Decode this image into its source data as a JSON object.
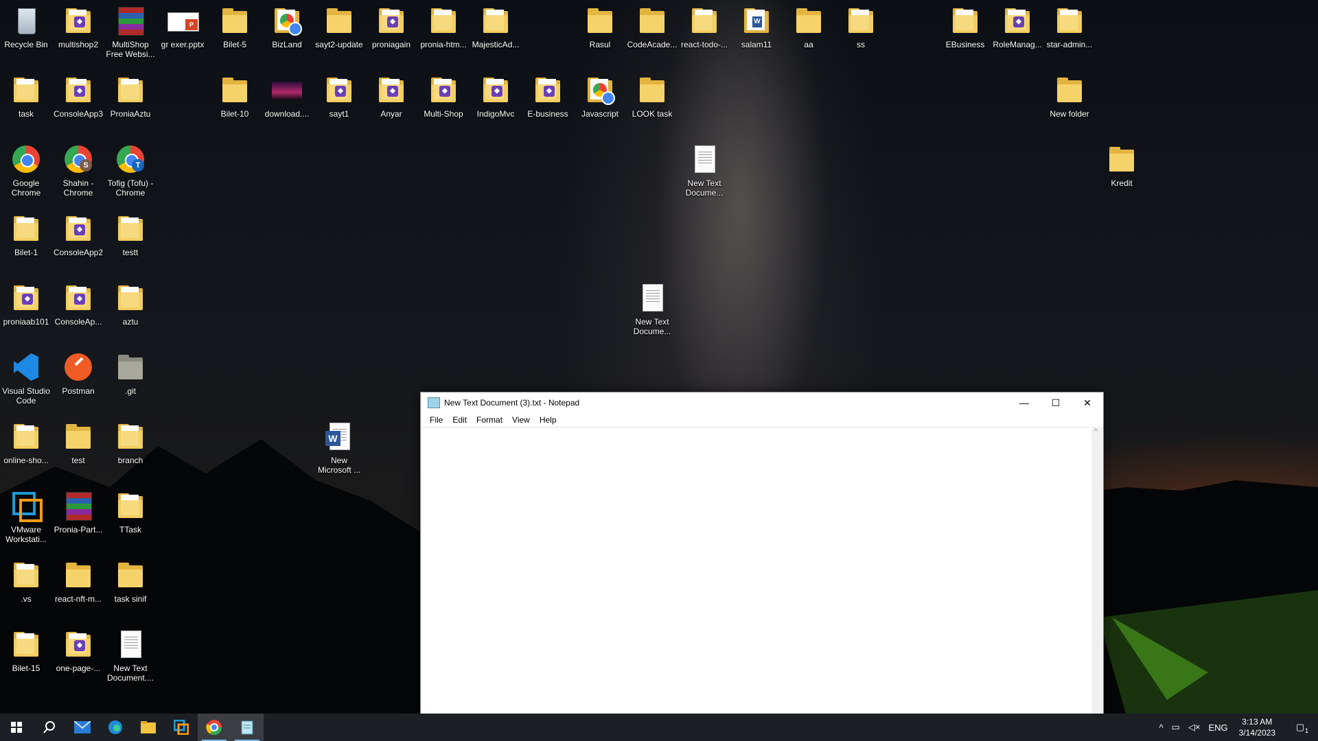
{
  "desktop_icons": [
    {
      "label": "Recycle Bin",
      "type": "recycle"
    },
    {
      "label": "multishop2",
      "type": "folder-vs"
    },
    {
      "label": "MultiShop Free Websi...",
      "type": "archive"
    },
    {
      "label": "gr exer.pptx",
      "type": "pptx"
    },
    {
      "label": "Bilet-5",
      "type": "folder"
    },
    {
      "label": "BizLand",
      "type": "folder-chrome"
    },
    {
      "label": "sayt2-update",
      "type": "folder"
    },
    {
      "label": "proniagain",
      "type": "folder-vs"
    },
    {
      "label": "pronia-htm...",
      "type": "folder-doc"
    },
    {
      "label": "MajesticAd...",
      "type": "folder-doc"
    },
    {
      "label": "Rasul",
      "type": "folder"
    },
    {
      "label": "CodeAcade...",
      "type": "folder"
    },
    {
      "label": "react-todo-...",
      "type": "folder-doc"
    },
    {
      "label": "salam11",
      "type": "folder-word"
    },
    {
      "label": "aa",
      "type": "folder"
    },
    {
      "label": "ss",
      "type": "folder-doc"
    },
    {
      "label": "EBusiness",
      "type": "folder-doc"
    },
    {
      "label": "RoleManag...",
      "type": "folder-vs"
    },
    {
      "label": "star-admin...",
      "type": "folder-doc"
    },
    {
      "label": "task",
      "type": "folder-doc"
    },
    {
      "label": "ConsoleApp3",
      "type": "folder-vs"
    },
    {
      "label": "ProniaAztu",
      "type": "folder-doc"
    },
    {
      "label": "Bilet-10",
      "type": "folder"
    },
    {
      "label": "download....",
      "type": "image"
    },
    {
      "label": "sayt1",
      "type": "folder-vs"
    },
    {
      "label": "Anyar",
      "type": "folder-vs"
    },
    {
      "label": "Multi-Shop",
      "type": "folder-vs"
    },
    {
      "label": "IndigoMvc",
      "type": "folder-vs"
    },
    {
      "label": "E-business",
      "type": "folder-vs"
    },
    {
      "label": "Javascript",
      "type": "folder-chrome"
    },
    {
      "label": "LOOK task",
      "type": "folder"
    },
    {
      "label": "New folder",
      "type": "folder"
    },
    {
      "label": "Google Chrome",
      "type": "chrome"
    },
    {
      "label": "Shahin - Chrome",
      "type": "chrome-s"
    },
    {
      "label": "Tofig (Tofu) - Chrome",
      "type": "chrome-t"
    },
    {
      "label": "New Text Docume...",
      "type": "text"
    },
    {
      "label": "Kredit",
      "type": "folder"
    },
    {
      "label": "Bilet-1",
      "type": "folder-doc"
    },
    {
      "label": "ConsoleApp2",
      "type": "folder-vs"
    },
    {
      "label": "testt",
      "type": "folder-doc"
    },
    {
      "label": "proniaab101",
      "type": "folder-vs"
    },
    {
      "label": "ConsoleAp...",
      "type": "folder-vs"
    },
    {
      "label": "aztu",
      "type": "folder-doc"
    },
    {
      "label": "New Text Docume...",
      "type": "text"
    },
    {
      "label": "Visual Studio Code",
      "type": "vscode"
    },
    {
      "label": "Postman",
      "type": "postman"
    },
    {
      "label": ".git",
      "type": "folder-gray"
    },
    {
      "label": "online-sho...",
      "type": "folder-doc"
    },
    {
      "label": "test",
      "type": "folder"
    },
    {
      "label": "branch",
      "type": "folder-doc"
    },
    {
      "label": "New Microsoft ...",
      "type": "word"
    },
    {
      "label": "VMware Workstati...",
      "type": "vmware"
    },
    {
      "label": "Pronia-Part...",
      "type": "archive"
    },
    {
      "label": "TTask",
      "type": "folder-doc"
    },
    {
      "label": ".vs",
      "type": "folder-doc"
    },
    {
      "label": "react-nft-m...",
      "type": "folder"
    },
    {
      "label": "task sinif",
      "type": "folder"
    },
    {
      "label": "Bilet-15",
      "type": "folder-doc"
    },
    {
      "label": "one-page-...",
      "type": "folder-vs"
    },
    {
      "label": "New Text Document....",
      "type": "text"
    }
  ],
  "notepad": {
    "title": "New Text Document (3).txt - Notepad",
    "menu": [
      "File",
      "Edit",
      "Format",
      "View",
      "Help"
    ],
    "content": "",
    "controls": {
      "minimize": "—",
      "maximize": "☐",
      "close": "✕"
    }
  },
  "taskbar": {
    "items": [
      "start-icon",
      "search-icon",
      "mail-icon",
      "edge-icon",
      "file-explorer-icon",
      "vmware-icon",
      "chrome-icon",
      "notepad-icon"
    ],
    "tray": {
      "language": "ENG",
      "time": "3:13 AM",
      "date": "3/14/2023",
      "notifications": "1"
    }
  },
  "colors": {
    "taskbar": "#1c1f24",
    "folder": "#f6d36a",
    "accent": "#76b9ed"
  }
}
